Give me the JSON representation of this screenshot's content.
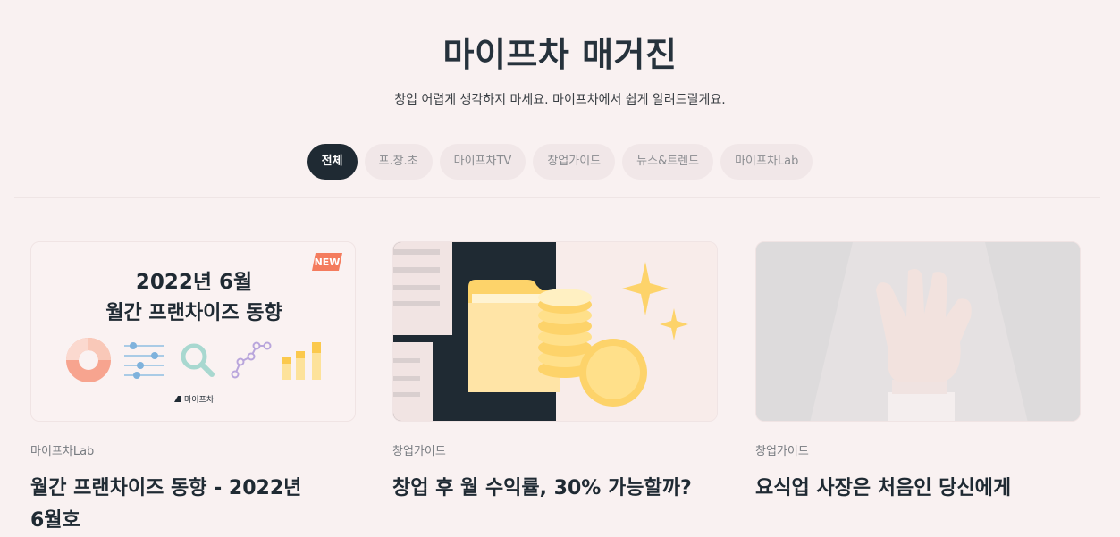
{
  "header": {
    "title": "마이프차 매거진",
    "subtitle": "창업 어렵게 생각하지 마세요. 마이프차에서 쉽게 알려드릴게요."
  },
  "tabs": [
    {
      "label": "전체",
      "active": true
    },
    {
      "label": "프.창.초"
    },
    {
      "label": "마이프차TV"
    },
    {
      "label": "창업가이드"
    },
    {
      "label": "뉴스&트렌드"
    },
    {
      "label": "마이프차Lab"
    }
  ],
  "cards": [
    {
      "category": "마이프차Lab",
      "title": "월간 프랜차이즈 동향 - 2022년 6월호",
      "thumb": {
        "badge": "NEW",
        "line1": "2022년 6월",
        "line2": "월간 프랜차이즈 동향",
        "logo_text": "마이프차"
      }
    },
    {
      "category": "창업가이드",
      "title": "창업 후 월 수익률, 30% 가능할까?"
    },
    {
      "category": "창업가이드",
      "title": "요식업 사장은 처음인 당신에게"
    }
  ],
  "colors": {
    "background": "#f9f1f1",
    "dark": "#1f2a33",
    "tab_bg": "#f1e7e8",
    "badge": "#f47c5e",
    "coin": "#fdd36a"
  }
}
